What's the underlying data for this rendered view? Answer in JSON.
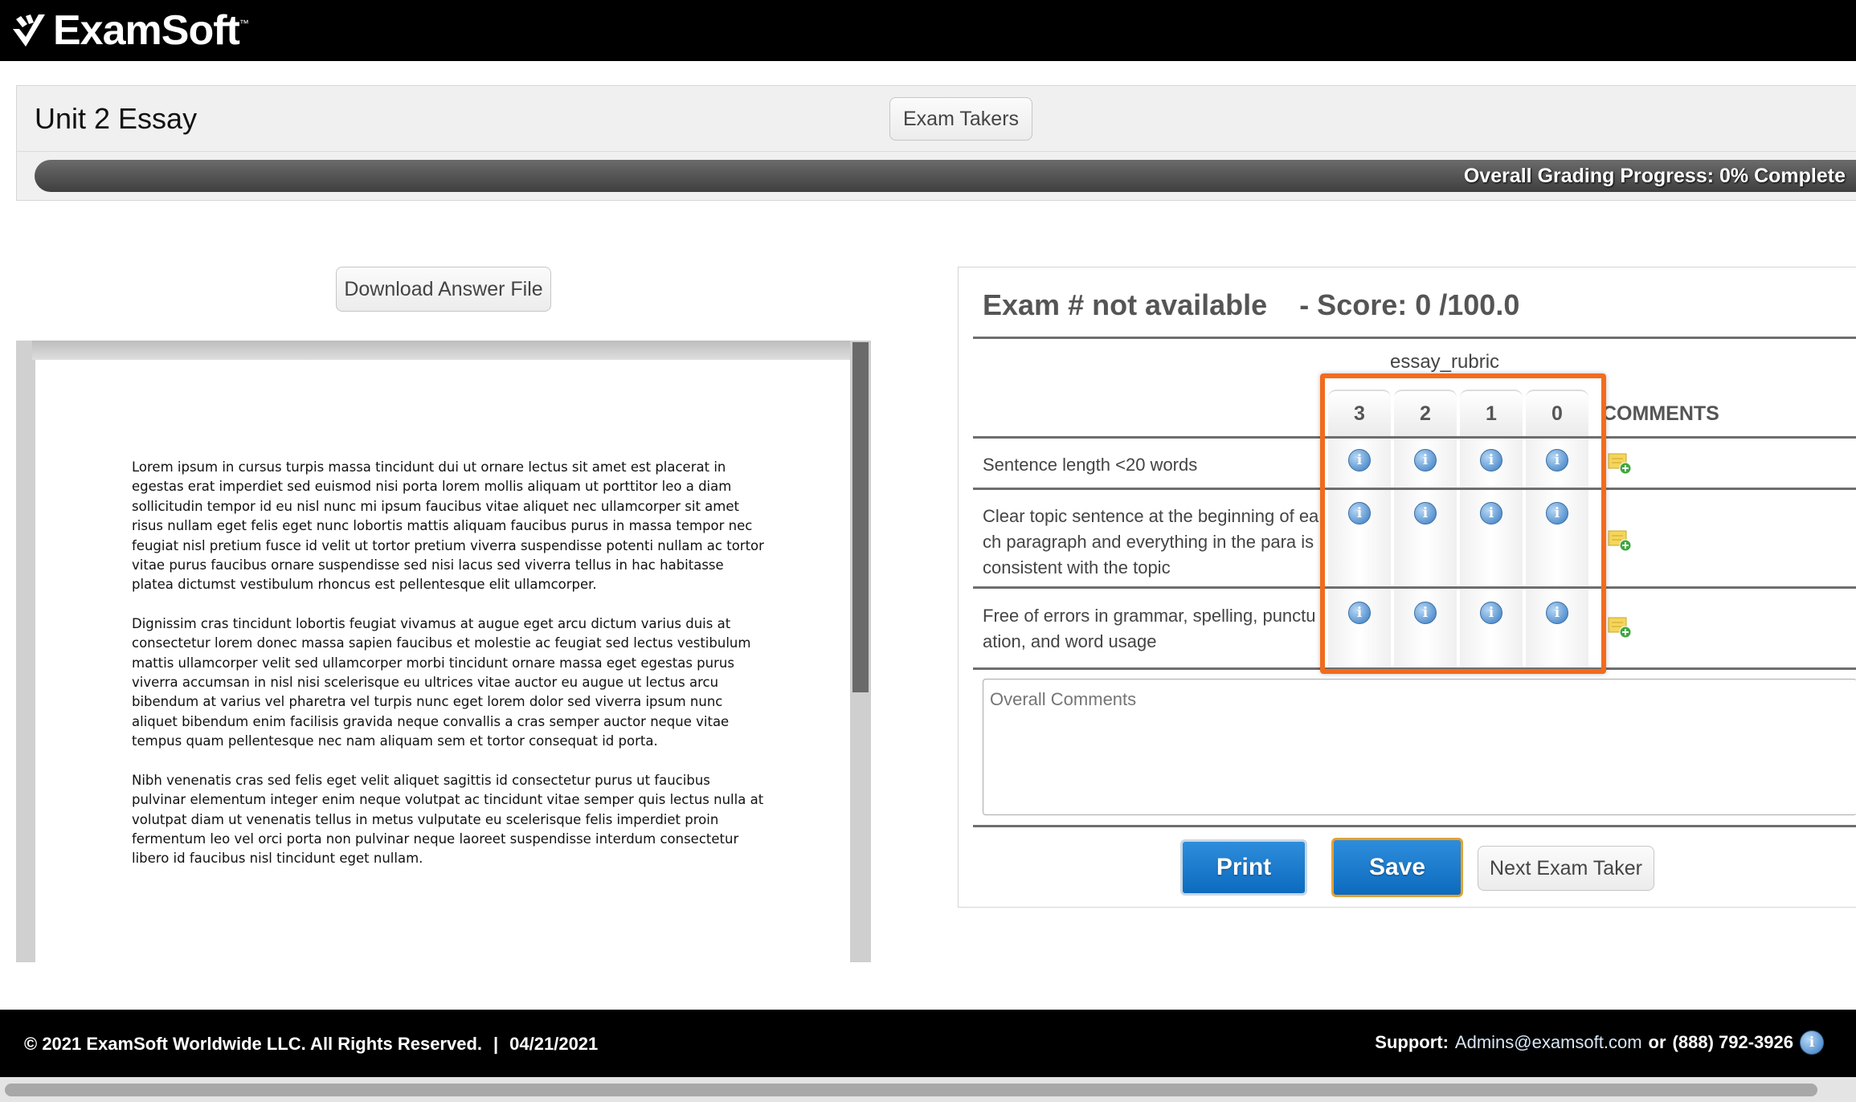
{
  "header": {
    "brand": "ExamSoft",
    "tm": "™"
  },
  "exam": {
    "name": "Unit 2 Essay",
    "exam_takers_label": "Exam Takers",
    "progress_label": "Overall Grading Progress: 0% Complete",
    "progress_fraction": 0
  },
  "answer": {
    "download_label": "Download Answer File",
    "paragraphs": [
      "Lorem ipsum in cursus turpis massa tincidunt dui ut ornare lectus sit amet est placerat in egestas erat imperdiet sed euismod nisi porta lorem mollis aliquam ut porttitor leo a diam sollicitudin tempor id eu nisl nunc mi ipsum faucibus vitae aliquet nec ullamcorper sit amet risus nullam eget felis eget nunc lobortis mattis aliquam faucibus purus in massa tempor nec feugiat nisl pretium fusce id velit ut tortor pretium viverra suspendisse potenti nullam ac tortor vitae purus faucibus ornare suspendisse sed nisi lacus sed viverra tellus in hac habitasse platea dictumst vestibulum rhoncus est pellentesque elit ullamcorper.",
      "Dignissim cras tincidunt lobortis feugiat vivamus at augue eget arcu dictum varius duis at consectetur lorem donec massa sapien faucibus et molestie ac feugiat sed lectus vestibulum mattis ullamcorper velit sed ullamcorper morbi tincidunt ornare massa eget egestas purus viverra accumsan in nisl nisi scelerisque eu ultrices vitae auctor eu augue ut lectus arcu bibendum at varius vel pharetra vel turpis nunc eget lorem dolor sed viverra ipsum nunc aliquet bibendum enim facilisis gravida neque convallis a cras semper auctor neque vitae tempus quam pellentesque nec nam aliquam sem et tortor consequat id porta.",
      "Nibh venenatis cras sed felis eget velit aliquet sagittis id consectetur purus ut faucibus pulvinar elementum integer enim neque volutpat ac tincidunt vitae semper quis lectus nulla at volutpat diam ut venenatis tellus in metus vulputate eu scelerisque felis imperdiet proin fermentum leo vel orci porta non pulvinar neque laoreet suspendisse interdum consectetur libero id faucibus nisl tincidunt eget nullam."
    ]
  },
  "grading": {
    "exam_label": "Exam # not available",
    "score_label": "- Score: 0 /100.0",
    "rubric_name": "essay_rubric",
    "columns": [
      "3",
      "2",
      "1",
      "0"
    ],
    "comments_header": "COMMENTS",
    "criteria": [
      "Sentence length <20 words",
      "Clear topic sentence at the beginning of each paragraph and everything in the para is consistent with the topic",
      "Free of errors in grammar, spelling, punctuation, and word usage"
    ],
    "info_glyph": "i",
    "overall_comments_placeholder": "Overall Comments",
    "print_label": "Print",
    "save_label": "Save",
    "next_label": "Next Exam Taker"
  },
  "footer": {
    "copyright": "© 2021 ExamSoft Worldwide LLC. All Rights Reserved.",
    "separator": "|",
    "date": "04/21/2021",
    "support_label": "Support:",
    "support_email": "Admins@examsoft.com",
    "or_label": "or",
    "support_phone": "(888) 792-3926"
  },
  "colors": {
    "highlight": "#f26b1d",
    "primary": "#1a7ad0",
    "save_border": "#e3a233"
  }
}
